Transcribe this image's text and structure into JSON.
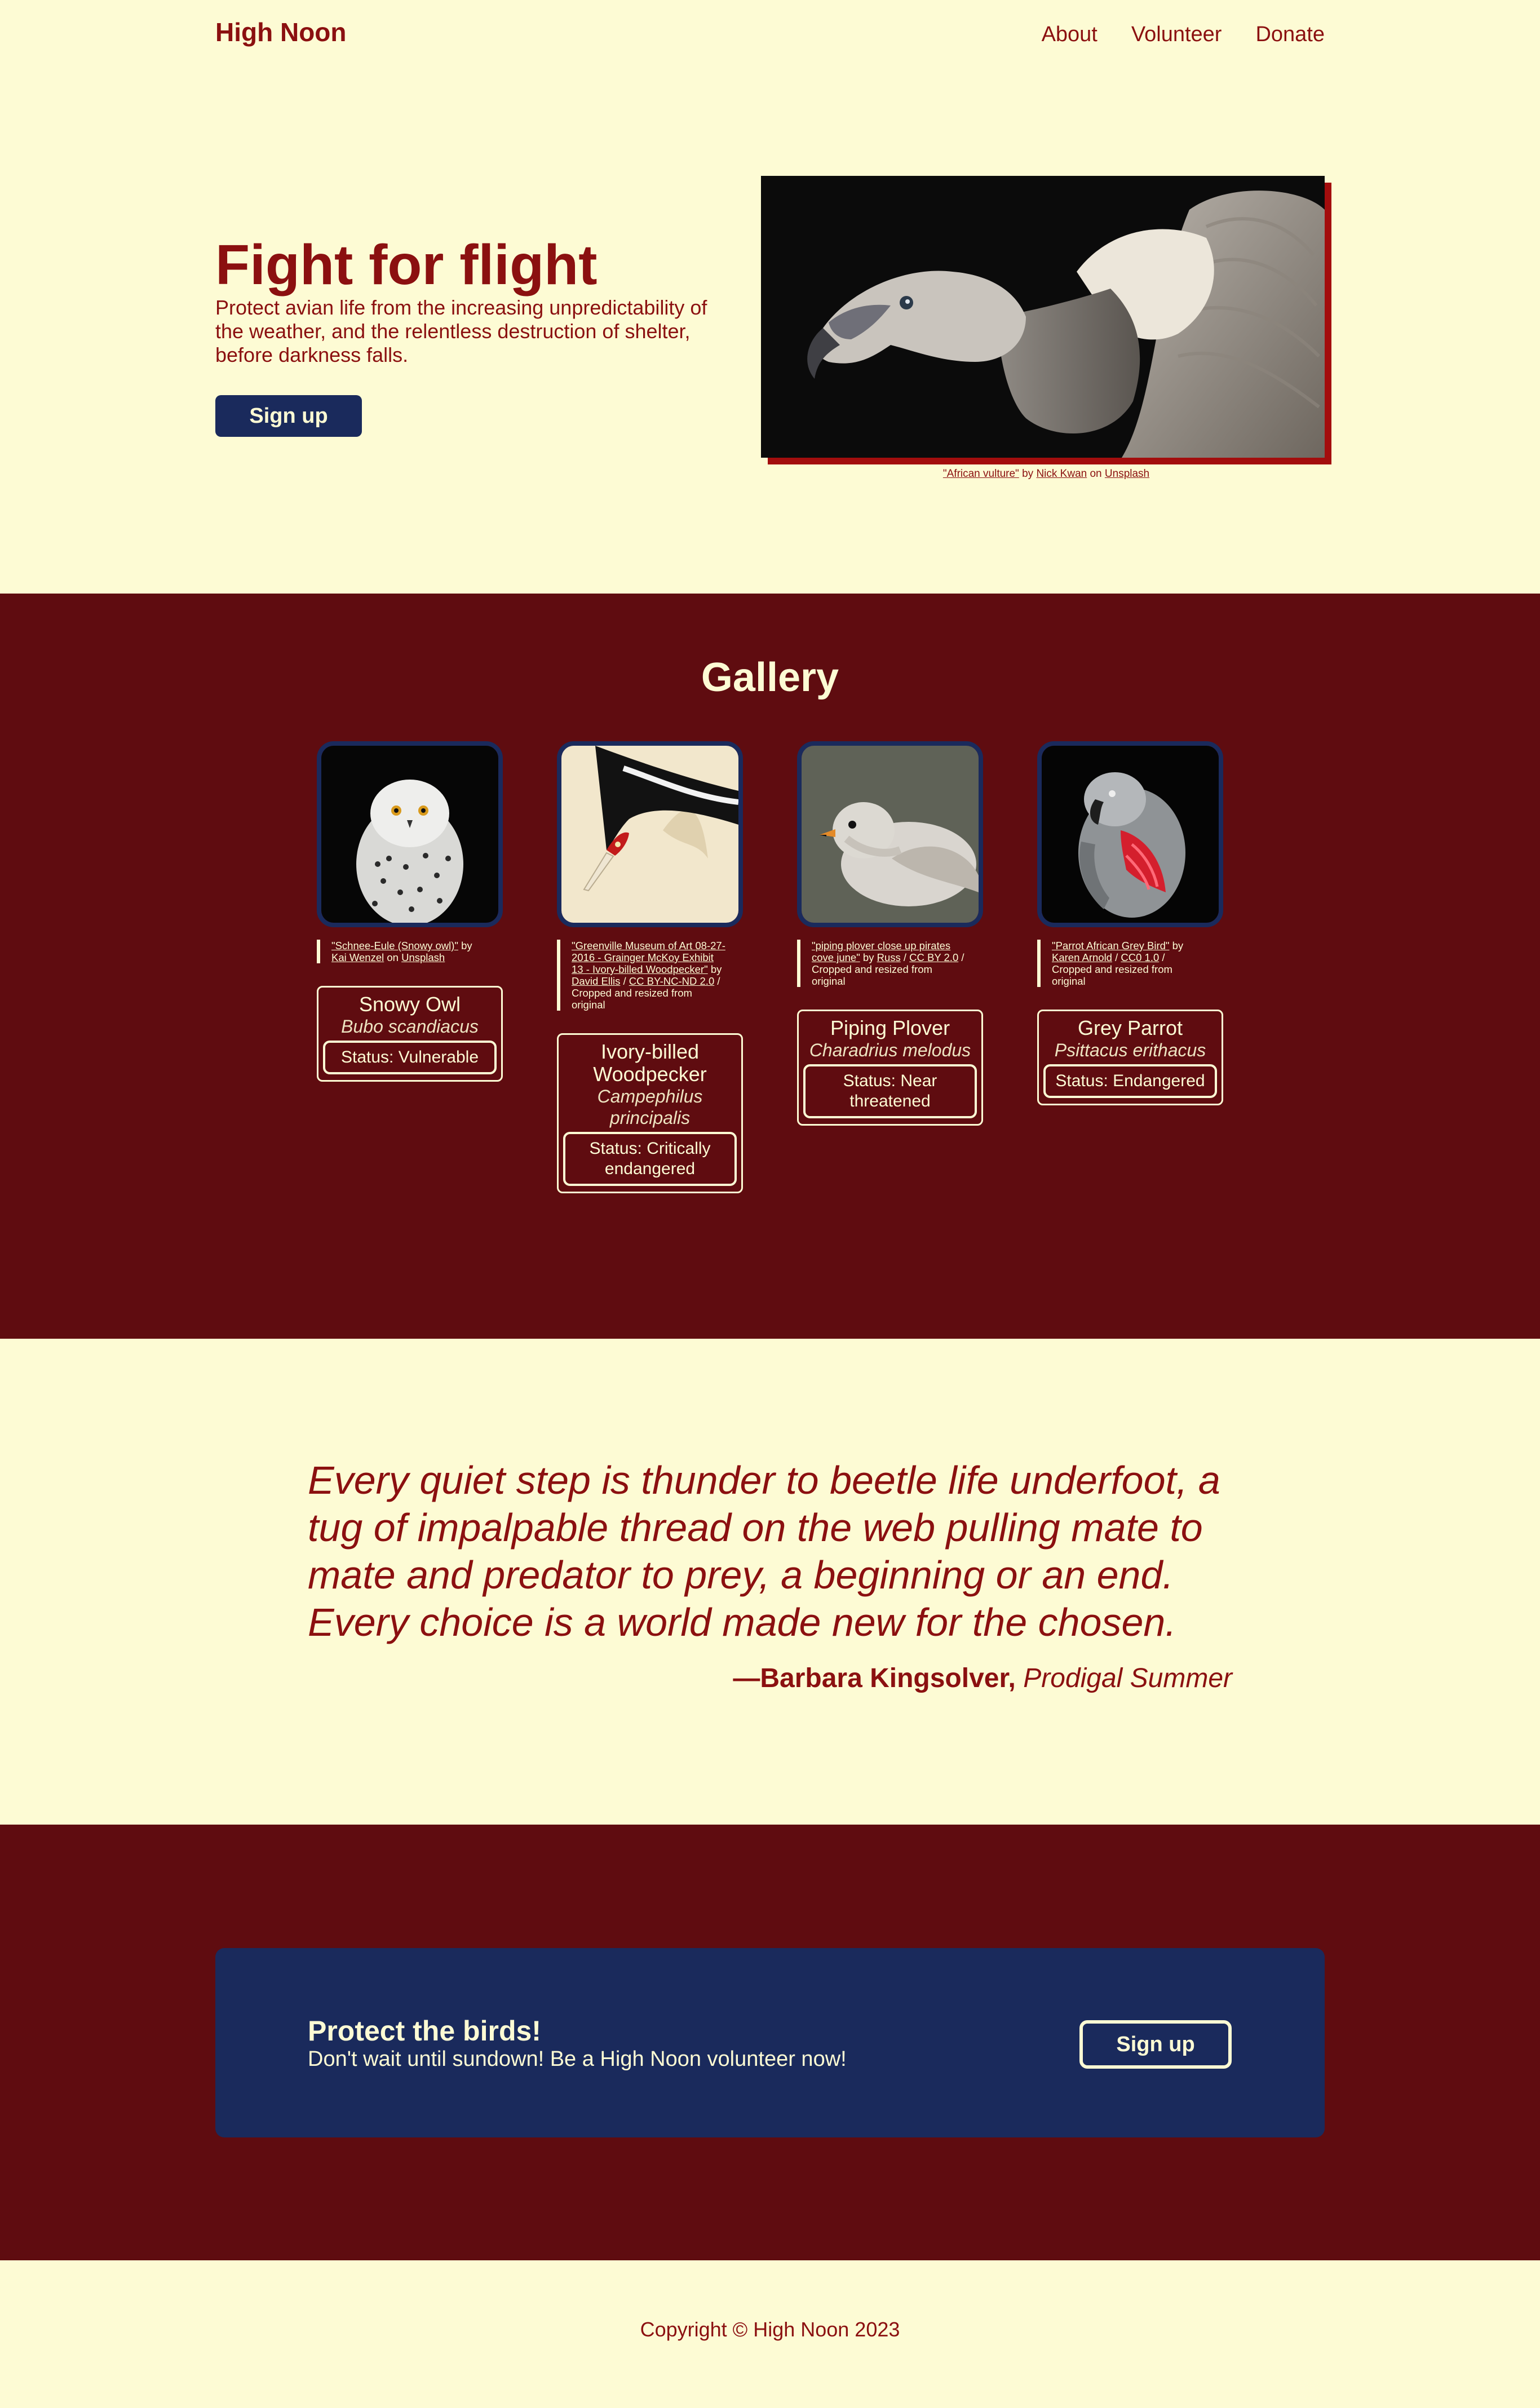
{
  "colors": {
    "background": "#fdfbd4",
    "accent": "#8b1010",
    "maroon": "#5f0c10",
    "navy": "#1a2a5c"
  },
  "header": {
    "logo": "High Noon",
    "nav": [
      "About",
      "Volunteer",
      "Donate"
    ]
  },
  "hero": {
    "title": "Fight for flight",
    "subtitle": "Protect avian life from the increasing unpredictability of the weather, and the relentless destruction of shelter, before darkness falls.",
    "signup_label": "Sign up",
    "caption": {
      "work": "\"African vulture\"",
      "by": "by",
      "author": "Nick Kwan",
      "on": "on",
      "source": "Unsplash"
    }
  },
  "gallery": {
    "title": "Gallery",
    "cards": [
      {
        "attribution_parts": [
          "\"Schnee-Eule (Snowy owl)\"",
          " by ",
          "Kai Wenzel",
          " on ",
          "Unsplash"
        ],
        "name": "Snowy Owl",
        "scientific": "Bubo scandiacus",
        "status": "Status: Vulnerable"
      },
      {
        "attribution_parts": [
          "\"Greenville Museum of Art 08-27-2016 - Grainger McKoy Exhibit 13 - Ivory-billed Woodpecker\"",
          " by ",
          "David Ellis",
          " / ",
          "CC BY-NC-ND 2.0",
          " / Cropped and resized from original"
        ],
        "name": "Ivory-billed Woodpecker",
        "scientific": "Campephilus principalis",
        "status": "Status: Critically endangered"
      },
      {
        "attribution_parts": [
          "\"piping plover close up pirates cove june\"",
          " by ",
          "Russ",
          " / ",
          "CC BY 2.0",
          " / Cropped and resized from original"
        ],
        "name": "Piping Plover",
        "scientific": "Charadrius melodus",
        "status": "Status: Near threatened"
      },
      {
        "attribution_parts": [
          "\"Parrot African Grey Bird\"",
          " by ",
          "Karen Arnold",
          " / ",
          "CC0 1.0",
          " / Cropped and resized from original"
        ],
        "name": "Grey Parrot",
        "scientific": "Psittacus erithacus",
        "status": "Status: Endangered"
      }
    ]
  },
  "quote": {
    "text": "Every quiet step is thunder to beetle life underfoot, a tug of impalpable thread on the web pulling mate to mate and predator to prey, a beginning or an end. Every choice is a world made new for the chosen.",
    "author": "—Barbara Kingsolver,",
    "work": "Prodigal Summer"
  },
  "cta": {
    "title": "Protect the birds!",
    "subtitle": "Don't wait until sundown! Be a High Noon volunteer now!",
    "button": "Sign up"
  },
  "footer": {
    "copyright": "Copyright © High Noon 2023"
  }
}
